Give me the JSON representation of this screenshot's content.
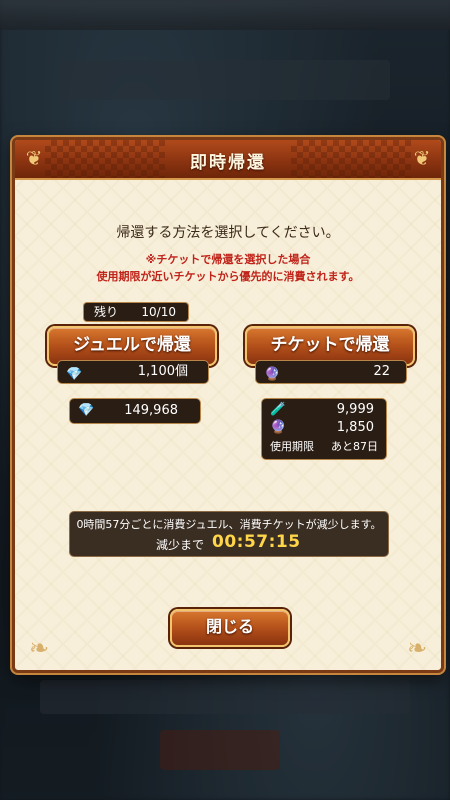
{
  "dialog": {
    "title": "即時帰還",
    "lead": "帰還する方法を選択してください。",
    "note_line1": "※チケットで帰還を選択した場合",
    "note_line2": "使用期限が近いチケットから優先的に消費されます。",
    "remaining": {
      "label": "残り",
      "count": "10/10"
    },
    "jewel_option": {
      "label": "ジュエルで帰還",
      "cost": "1,100個",
      "icon": "jewel-icon"
    },
    "ticket_option": {
      "label": "チケットで帰還",
      "cost": "22",
      "icon": "ticket-icon"
    },
    "owned_jewels": "149,968",
    "owned_tickets": {
      "row1": "9,999",
      "row2": "1,850",
      "expiry_label": "使用期限",
      "expiry_value": "あと87日"
    },
    "timer": {
      "message": "0時間57分ごとに消費ジュエル、消費チケットが減少します。",
      "label": "減少まで",
      "value": "00:57:15"
    },
    "close_label": "閉じる"
  },
  "colors": {
    "header": "#8c3411",
    "panel": "#f7efd9",
    "warning_text": "#c0231a",
    "timer_text": "#ffd64a"
  }
}
